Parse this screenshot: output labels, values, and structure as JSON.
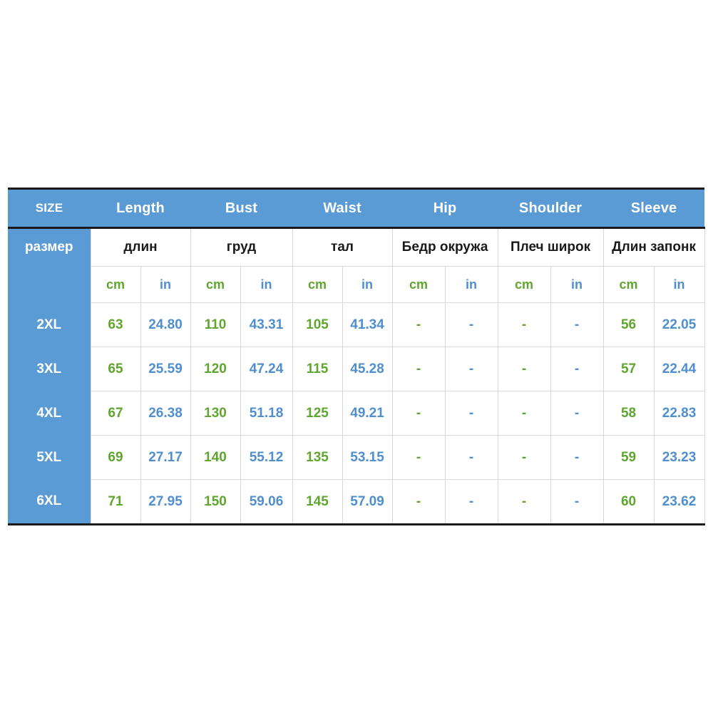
{
  "chart": {
    "header_en": [
      "SIZE",
      "Length",
      "Bust",
      "Waist",
      "Hip",
      "Shoulder",
      "Sleeve"
    ],
    "header_ru": [
      "размер",
      "длин",
      "груд",
      "тал",
      "Бедр окружа",
      "Плеч широк",
      "Длин запонк"
    ],
    "unit_cm": "cm",
    "unit_in": "in",
    "units_row": [
      "cm",
      "in",
      "cm",
      "in",
      "cm",
      "in",
      "cm",
      "in",
      "cm",
      "in",
      "cm",
      "in"
    ],
    "rows": [
      {
        "size": "2XL",
        "length_cm": "63",
        "length_in": "24.80",
        "bust_cm": "110",
        "bust_in": "43.31",
        "waist_cm": "105",
        "waist_in": "41.34",
        "hip_cm": "-",
        "hip_in": "-",
        "shoulder_cm": "-",
        "shoulder_in": "-",
        "sleeve_cm": "56",
        "sleeve_in": "22.05"
      },
      {
        "size": "3XL",
        "length_cm": "65",
        "length_in": "25.59",
        "bust_cm": "120",
        "bust_in": "47.24",
        "waist_cm": "115",
        "waist_in": "45.28",
        "hip_cm": "-",
        "hip_in": "-",
        "shoulder_cm": "-",
        "shoulder_in": "-",
        "sleeve_cm": "57",
        "sleeve_in": "22.44"
      },
      {
        "size": "4XL",
        "length_cm": "67",
        "length_in": "26.38",
        "bust_cm": "130",
        "bust_in": "51.18",
        "waist_cm": "125",
        "waist_in": "49.21",
        "hip_cm": "-",
        "hip_in": "-",
        "shoulder_cm": "-",
        "shoulder_in": "-",
        "sleeve_cm": "58",
        "sleeve_in": "22.83"
      },
      {
        "size": "5XL",
        "length_cm": "69",
        "length_in": "27.17",
        "bust_cm": "140",
        "bust_in": "55.12",
        "waist_cm": "135",
        "waist_in": "53.15",
        "hip_cm": "-",
        "hip_in": "-",
        "shoulder_cm": "-",
        "shoulder_in": "-",
        "sleeve_cm": "59",
        "sleeve_in": "23.23"
      },
      {
        "size": "6XL",
        "length_cm": "71",
        "length_in": "27.95",
        "bust_cm": "150",
        "bust_in": "59.06",
        "waist_cm": "145",
        "waist_in": "57.09",
        "hip_cm": "-",
        "hip_in": "-",
        "shoulder_cm": "-",
        "shoulder_in": "-",
        "sleeve_cm": "60",
        "sleeve_in": "23.62"
      }
    ],
    "colors": {
      "header_blue": "#5B9BD5",
      "cm_green": "#5FA52E",
      "in_blue": "#4F8FD0",
      "grid": "#d9d9d9",
      "outline": "#1a1a1a"
    }
  }
}
